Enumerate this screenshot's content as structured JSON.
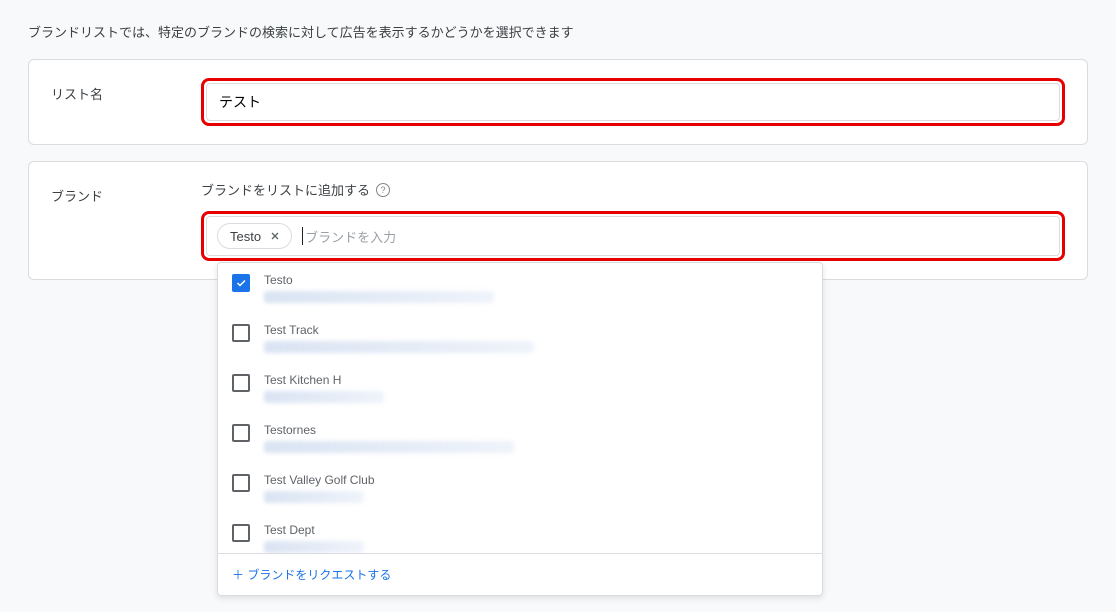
{
  "description": "ブランドリストでは、特定のブランドの検索に対して広告を表示するかどうかを選択できます",
  "listName": {
    "label": "リスト名",
    "value": "テスト"
  },
  "brand": {
    "label": "ブランド",
    "subtitle": "ブランドをリストに追加する",
    "chip": "Testo",
    "placeholder": "ブランドを入力",
    "options": [
      {
        "title": "Testo",
        "checked": true,
        "subWidth": 230
      },
      {
        "title": "Test Track",
        "checked": false,
        "subWidth": 270
      },
      {
        "title": "Test Kitchen H",
        "checked": false,
        "subWidth": 120
      },
      {
        "title": "Testornes",
        "checked": false,
        "subWidth": 250
      },
      {
        "title": "Test Valley Golf Club",
        "checked": false,
        "subWidth": 100
      },
      {
        "title": "Test Dept",
        "checked": false,
        "subWidth": 100
      }
    ],
    "requestLink": "＋ ブランドをリクエストする"
  }
}
